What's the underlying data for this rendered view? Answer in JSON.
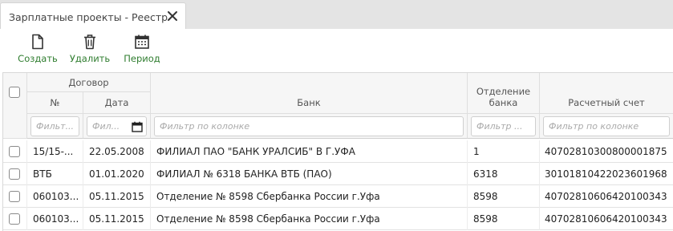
{
  "tab": {
    "title": "Зарплатные проекты - Реестр"
  },
  "toolbar": {
    "create_label": "Создать",
    "delete_label": "Удалить",
    "period_label": "Период"
  },
  "columns": {
    "group_label": "Договор",
    "number": "№",
    "date": "Дата",
    "bank": "Банк",
    "branch": "Отделение банка",
    "account": "Расчетный счет"
  },
  "filters": {
    "number_placeholder": "Фильт...",
    "date_placeholder": "Фил...",
    "bank_placeholder": "Фильтр по колонке",
    "branch_placeholder": "Фильтр ...",
    "account_placeholder": "Фильтр по колонке"
  },
  "rows": [
    {
      "number": "15/15-...",
      "date": "22.05.2008",
      "bank": "ФИЛИАЛ ПАО \"БАНК УРАЛСИБ\" В Г.УФА",
      "branch": "1",
      "account": "40702810300800001875"
    },
    {
      "number": "ВТБ",
      "date": "01.01.2020",
      "bank": "ФИЛИАЛ № 6318 БАНКА ВТБ (ПАО)",
      "branch": "6318",
      "account": "30101810422023601968"
    },
    {
      "number": "060103...",
      "date": "05.11.2015",
      "bank": "Отделение № 8598 Сбербанка России г.Уфа",
      "branch": "8598",
      "account": "40702810606420100343"
    },
    {
      "number": "060103...",
      "date": "05.11.2015",
      "bank": "Отделение № 8598 Сбербанка России г.Уфа",
      "branch": "8598",
      "account": "40702810606420100343"
    }
  ],
  "icons": {
    "create": "new-document-icon",
    "delete": "trash-icon",
    "period": "calendar-icon",
    "close": "close-icon"
  },
  "colors": {
    "toolbar_label": "#2f7d2f",
    "tabbar_bg": "#e4e4e4",
    "header_bg": "#f6f6f6"
  }
}
